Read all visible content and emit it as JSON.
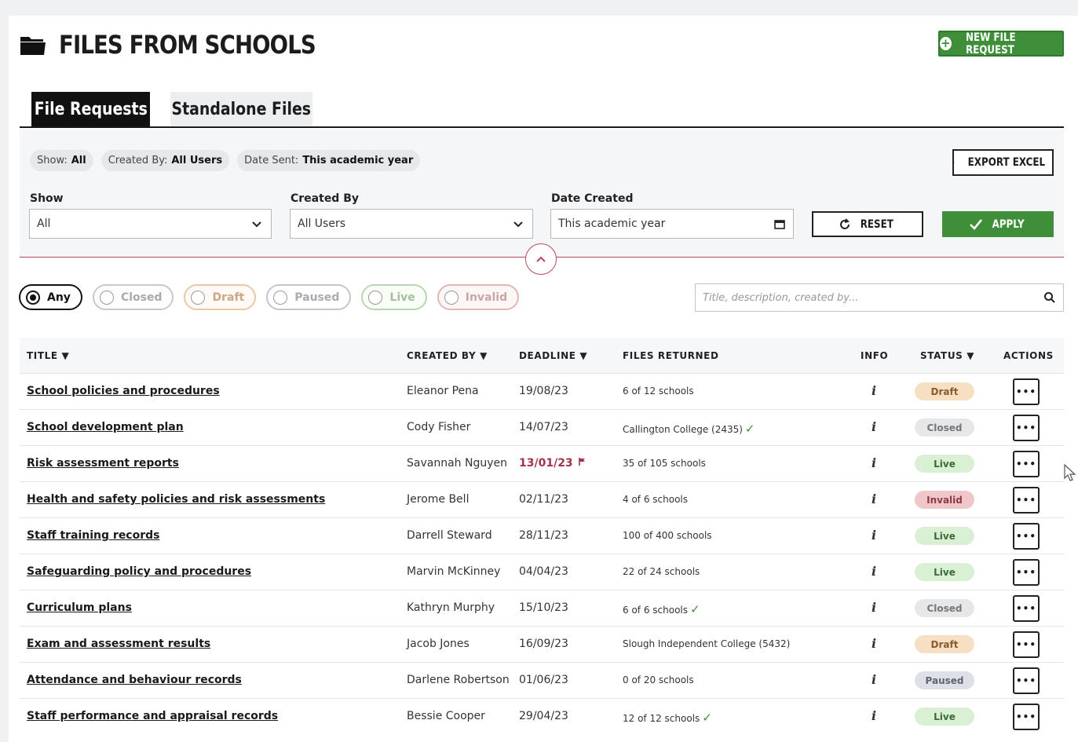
{
  "page": {
    "title": "FILES FROM SCHOOLS",
    "new_request_label": "NEW FILE REQUEST"
  },
  "tabs": [
    {
      "label": "File Requests",
      "active": true
    },
    {
      "label": "Standalone Files",
      "active": false
    }
  ],
  "chips": [
    {
      "key": "Show:",
      "value": "All"
    },
    {
      "key": "Created By:",
      "value": "All Users"
    },
    {
      "key": "Date Sent:",
      "value": "This academic year"
    }
  ],
  "export_label": "EXPORT EXCEL",
  "filters": {
    "show": {
      "label": "Show",
      "value": "All"
    },
    "created_by": {
      "label": "Created By",
      "value": "All Users"
    },
    "date_created": {
      "label": "Date Created",
      "value": "This academic year"
    },
    "reset_label": "RESET",
    "apply_label": "APPLY"
  },
  "status_filters": [
    {
      "label": "Any",
      "selected": true
    },
    {
      "label": "Closed",
      "selected": false
    },
    {
      "label": "Draft",
      "selected": false
    },
    {
      "label": "Paused",
      "selected": false
    },
    {
      "label": "Live",
      "selected": false
    },
    {
      "label": "Invalid",
      "selected": false
    }
  ],
  "search": {
    "placeholder": "Title, description, created by..."
  },
  "table": {
    "headers": {
      "title": "TITLE ▼",
      "created_by": "CREATED BY ▼",
      "deadline": "DEADLINE ▼",
      "files_returned": "FILES RETURNED",
      "info": "INFO",
      "status": "STATUS ▼",
      "actions": "ACTIONS"
    },
    "rows": [
      {
        "title": "School policies and procedures",
        "created_by": "Eleanor Pena",
        "deadline": "19/08/23",
        "overdue": false,
        "files": "6 of 12 schools",
        "check": false,
        "status": "Draft"
      },
      {
        "title": "School development plan",
        "created_by": "Cody Fisher",
        "deadline": "14/07/23",
        "overdue": false,
        "files": "Callington College (2435)",
        "check": true,
        "status": "Closed"
      },
      {
        "title": "Risk assessment reports",
        "created_by": "Savannah Nguyen",
        "deadline": "13/01/23",
        "overdue": true,
        "files": "35 of 105 schools",
        "check": false,
        "status": "Live"
      },
      {
        "title": "Health and safety policies and risk assessments",
        "created_by": "Jerome Bell",
        "deadline": "02/11/23",
        "overdue": false,
        "files": "4 of 6 schools",
        "check": false,
        "status": "Invalid"
      },
      {
        "title": "Staff training records",
        "created_by": "Darrell Steward",
        "deadline": "28/11/23",
        "overdue": false,
        "files": "100 of 400 schools",
        "check": false,
        "status": "Live"
      },
      {
        "title": "Safeguarding policy and procedures",
        "created_by": "Marvin McKinney",
        "deadline": "04/04/23",
        "overdue": false,
        "files": "22 of 24 schools",
        "check": false,
        "status": "Live"
      },
      {
        "title": "Curriculum plans",
        "created_by": "Kathryn Murphy",
        "deadline": "15/10/23",
        "overdue": false,
        "files": "6 of 6 schools",
        "check": true,
        "status": "Closed"
      },
      {
        "title": "Exam and assessment results",
        "created_by": "Jacob Jones",
        "deadline": "16/09/23",
        "overdue": false,
        "files": "Slough Independent College (5432)",
        "check": false,
        "status": "Draft"
      },
      {
        "title": "Attendance and behaviour records",
        "created_by": "Darlene Robertson",
        "deadline": "01/06/23",
        "overdue": false,
        "files": "0 of 20 schools",
        "check": false,
        "status": "Paused"
      },
      {
        "title": "Staff performance and appraisal records",
        "created_by": "Bessie Cooper",
        "deadline": "29/04/23",
        "overdue": false,
        "files": "12 of 12 schools",
        "check": true,
        "status": "Live"
      }
    ]
  },
  "colors": {
    "accent_green": "#3f8f3a",
    "divider_red": "#b9475b",
    "overdue_red": "#a3314a"
  }
}
